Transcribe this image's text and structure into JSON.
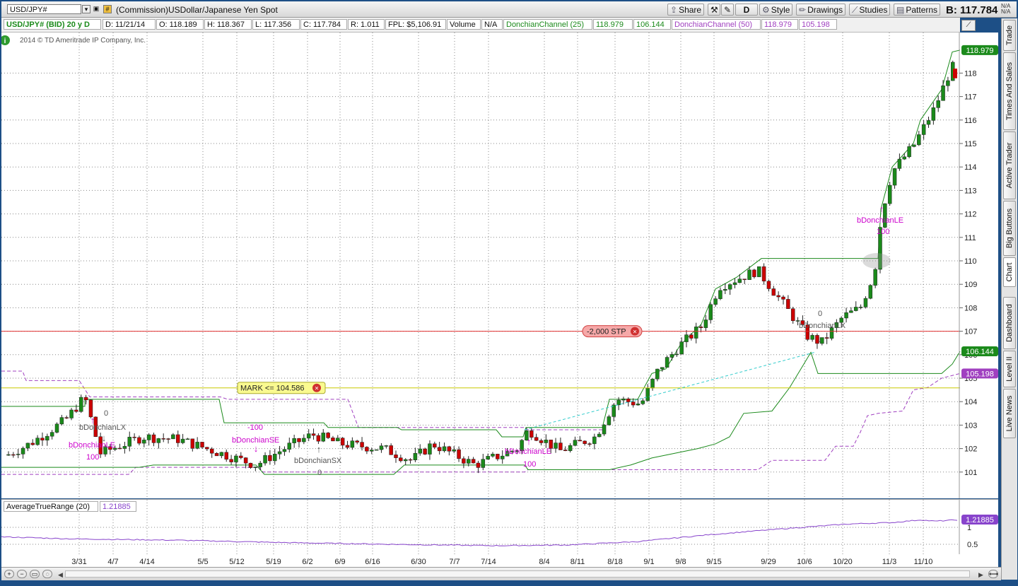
{
  "toolbar": {
    "symbol": "USD/JPY#",
    "title": "(Commission)USDollar/Japanese Yen Spot",
    "buttons": {
      "share": "Share",
      "period": "D",
      "style": "Style",
      "drawings": "Drawings",
      "studies": "Studies",
      "patterns": "Patterns"
    },
    "bid": "B: 117.784",
    "na": [
      "N/A",
      "N/A"
    ]
  },
  "infobar": {
    "symbol_period": "USD/JPY# (BID) 20 y D",
    "date": "D: 11/21/14",
    "open": "O: 118.189",
    "high": "H: 118.367",
    "low": "L: 117.356",
    "close": "C: 117.784",
    "range": "R: 1.011",
    "fpl": "FPL: $5,106.91",
    "volume": "Volume",
    "volume_val": "N/A",
    "dc25_name": "DonchianChannel (25)",
    "dc25_upper": "118.979",
    "dc25_lower": "106.144",
    "dc50_name": "DonchianChannel (50)",
    "dc50_upper": "118.979",
    "dc50_lower": "105.198"
  },
  "chart": {
    "copyright": "2014 © TD Ameritrade IP Company, Inc.",
    "mark_order": "MARK <= 104.586",
    "stop_order": "-2,000 STP",
    "price_tag_top": "118.979",
    "price_tag_mid": "106.144",
    "price_tag_low": "105.198",
    "y_ticks": [
      "118",
      "117",
      "116",
      "115",
      "114",
      "113",
      "112",
      "111",
      "110",
      "109",
      "108",
      "107",
      "106",
      "105",
      "104",
      "103",
      "102",
      "101"
    ],
    "x_ticks": [
      "3/31",
      "4/7",
      "4/14",
      "5/5",
      "5/12",
      "5/19",
      "6/2",
      "6/9",
      "6/16",
      "6/30",
      "7/7",
      "7/14",
      "8/4",
      "8/11",
      "8/18",
      "9/1",
      "9/8",
      "9/15",
      "9/29",
      "10/6",
      "10/20",
      "11/3",
      "11/10"
    ],
    "signals": [
      {
        "text": "0",
        "color": "#555555"
      },
      {
        "text": "bDonchianLX",
        "color": "#555555"
      },
      {
        "text": "bDonchianLE",
        "color": "#cc00cc"
      },
      {
        "text": "100",
        "color": "#cc00cc"
      },
      {
        "text": "-100",
        "color": "#cc00cc"
      },
      {
        "text": "bDonchianSE",
        "color": "#cc00cc"
      },
      {
        "text": "bDonchianSX",
        "color": "#555555"
      },
      {
        "text": "0",
        "color": "#555555"
      },
      {
        "text": "bDonchianLE",
        "color": "#cc00cc"
      },
      {
        "text": "100",
        "color": "#cc00cc"
      },
      {
        "text": "0",
        "color": "#555555"
      },
      {
        "text": "bDonchianLX",
        "color": "#555555"
      },
      {
        "text": "bDonchianLE",
        "color": "#cc00cc"
      },
      {
        "text": "100",
        "color": "#cc00cc"
      }
    ]
  },
  "lower": {
    "atr_name": "AverageTrueRange (20)",
    "atr_value": "1.21885",
    "atr_tag": "1.21885",
    "ticks": [
      "1",
      "0.5"
    ]
  },
  "sidebar": [
    "Trade",
    "Times And Sales",
    "Active Trader",
    "Big Buttons",
    "Chart",
    "Dashboard",
    "Level II",
    "Live News"
  ],
  "colors": {
    "up": "#1a8a1a",
    "down": "#cc0000",
    "dc25": "#1b8a1b",
    "dc50": "#a040c0",
    "stop": "#e03030",
    "mark": "#c8c800"
  }
}
